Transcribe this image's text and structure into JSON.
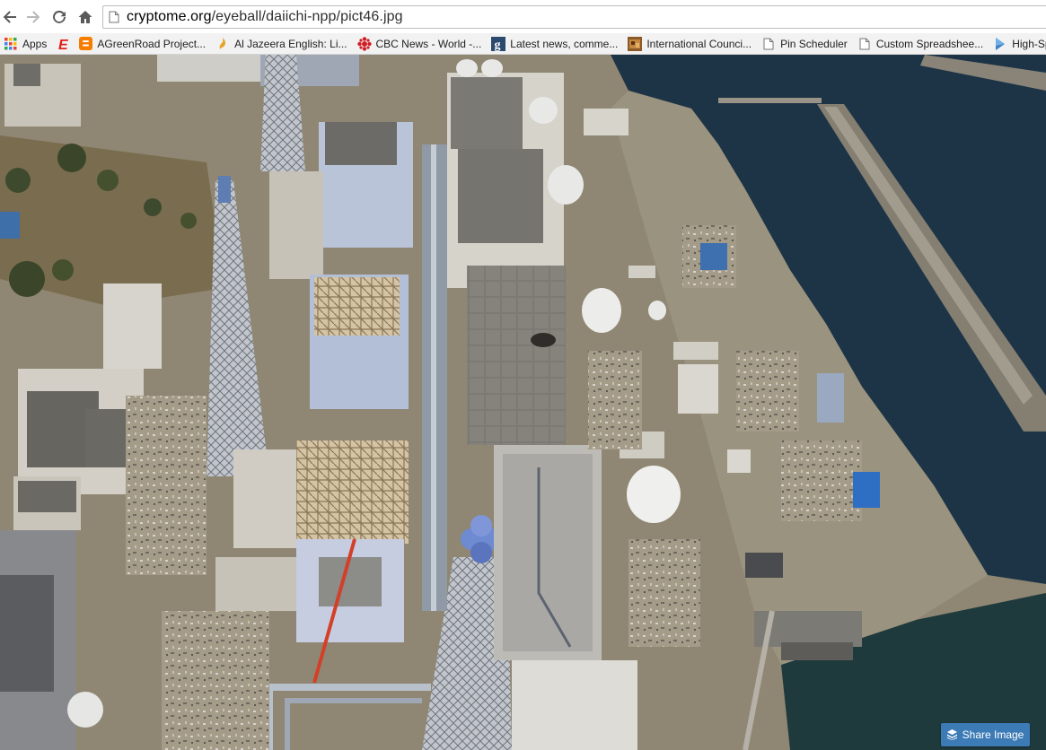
{
  "browser": {
    "url_host": "cryptome.org",
    "url_path": "/eyeball/daiichi-npp/pict46.jpg"
  },
  "bookmarks": [
    {
      "label": "Apps",
      "icon": "apps-grid-icon"
    },
    {
      "label": "",
      "icon": "engadget-e-icon"
    },
    {
      "label": "AGreenRoad Project...",
      "icon": "blogger-icon"
    },
    {
      "label": "Al Jazeera English: Li...",
      "icon": "al-jazeera-icon"
    },
    {
      "label": "CBC News - World -...",
      "icon": "cbc-icon"
    },
    {
      "label": "Latest news, comme...",
      "icon": "guardian-g-icon"
    },
    {
      "label": "International Counci...",
      "icon": "photo-favicon-icon"
    },
    {
      "label": "Pin Scheduler",
      "icon": "page-icon"
    },
    {
      "label": "Custom Spreadshee...",
      "icon": "page-icon"
    },
    {
      "label": "High-Spee",
      "icon": "play-arrow-icon"
    }
  ],
  "share": {
    "label": "Share Image",
    "icon": "stack-icon"
  },
  "colors": {
    "share_blue": "#3d7bb6",
    "sea": "#1b3344",
    "ground": "#8c8470"
  }
}
